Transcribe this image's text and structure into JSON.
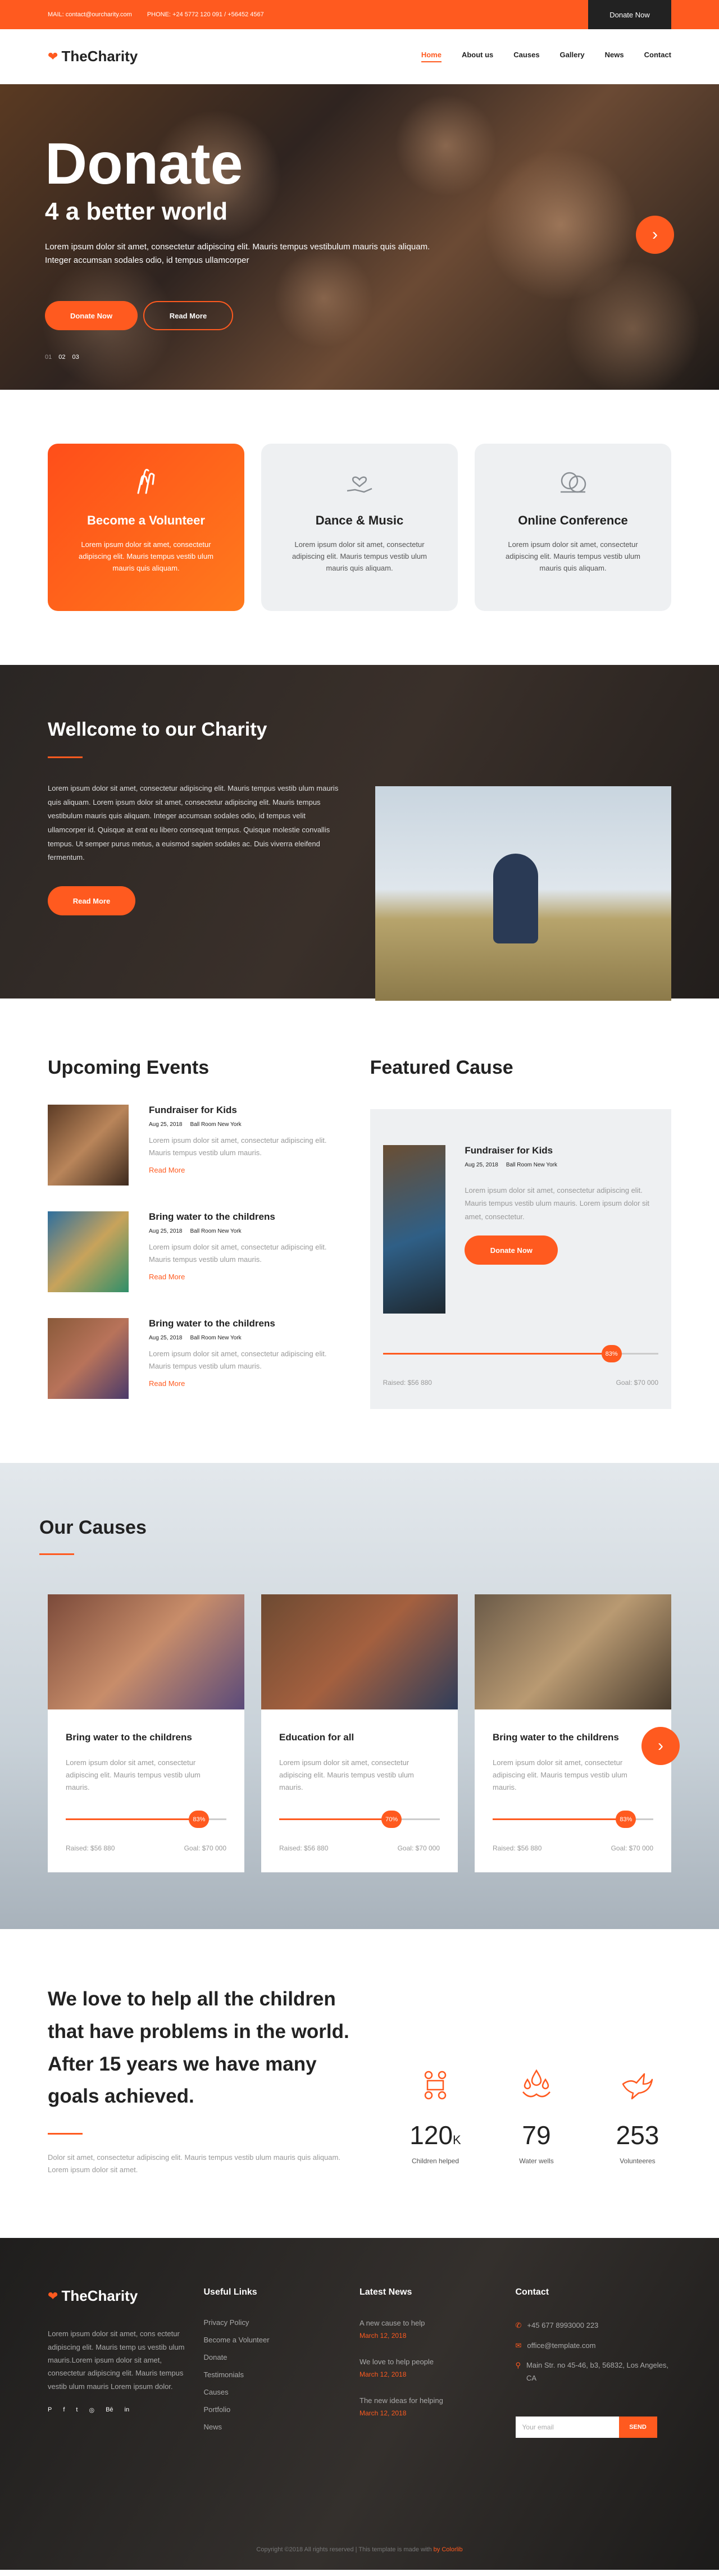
{
  "topbar": {
    "mail": "MAIL: contact@ourcharity.com",
    "phone": "PHONE: +24 5772 120 091 / +56452 4567",
    "donate": "Donate Now"
  },
  "nav": {
    "logo": "TheCharity",
    "items": [
      "Home",
      "About us",
      "Causes",
      "Gallery",
      "News",
      "Contact"
    ]
  },
  "hero": {
    "title": "Donate",
    "subtitle": "4 a better world",
    "text": "Lorem ipsum dolor sit amet, consectetur adipiscing elit. Mauris tempus vestibulum mauris quis aliquam. Integer accumsan sodales odio, id tempus ullamcorper",
    "btn_donate": "Donate Now",
    "btn_read": "Read More",
    "pages": [
      "01",
      "02",
      "03"
    ],
    "arrow": "›"
  },
  "features": [
    {
      "title": "Become a Volunteer",
      "text": "Lorem ipsum dolor sit amet, consectetur adipiscing elit. Mauris tempus vestib ulum mauris quis aliquam.",
      "icon": "hands-icon"
    },
    {
      "title": "Dance & Music",
      "text": "Lorem ipsum dolor sit amet, consectetur adipiscing elit. Mauris tempus vestib ulum mauris quis aliquam.",
      "icon": "heart-hand-icon"
    },
    {
      "title": "Online Conference",
      "text": "Lorem ipsum dolor sit amet, consectetur adipiscing elit. Mauris tempus vestib ulum mauris quis aliquam.",
      "icon": "money-icon"
    }
  ],
  "welcome": {
    "title": "Wellcome to our Charity",
    "text": "Lorem ipsum dolor sit amet, consectetur adipiscing elit. Mauris tempus vestib ulum mauris quis aliquam. Lorem ipsum dolor sit amet, consectetur adipiscing elit. Mauris tempus vestibulum mauris quis aliquam. Integer accumsan sodales odio, id tempus velit ullamcorper id. Quisque at erat eu libero consequat tempus. Quisque molestie convallis tempus. Ut semper purus metus, a euismod sapien sodales ac. Duis viverra eleifend fermentum.",
    "btn": "Read More"
  },
  "events": {
    "title": "Upcoming Events",
    "items": [
      {
        "title": "Fundraiser for Kids",
        "date": "Aug 25, 2018",
        "place": "Ball Room New York",
        "text": "Lorem ipsum dolor sit amet, consectetur adipiscing elit. Mauris tempus vestib ulum mauris.",
        "more": "Read More"
      },
      {
        "title": "Bring water to the childrens",
        "date": "Aug 25, 2018",
        "place": "Ball Room New York",
        "text": "Lorem ipsum dolor sit amet, consectetur adipiscing elit. Mauris tempus vestib ulum mauris.",
        "more": "Read More"
      },
      {
        "title": "Bring water to the childrens",
        "date": "Aug 25, 2018",
        "place": "Ball Room New York",
        "text": "Lorem ipsum dolor sit amet, consectetur adipiscing elit. Mauris tempus vestib ulum mauris.",
        "more": "Read More"
      }
    ]
  },
  "featured": {
    "title": "Featured Cause",
    "cause_title": "Fundraiser for Kids",
    "date": "Aug 25, 2018",
    "place": "Ball Room New York",
    "text": "Lorem ipsum dolor sit amet, consectetur adipiscing elit. Mauris tempus vestib ulum mauris. Lorem ipsum dolor sit amet, consectetur.",
    "btn": "Donate Now",
    "percent_label": "83%",
    "percent": 83,
    "raised": "Raised: $56 880",
    "goal": "Goal: $70 000"
  },
  "causes": {
    "title": "Our Causes",
    "items": [
      {
        "title": "Bring water to the childrens",
        "text": "Lorem ipsum dolor sit amet, consectetur adipiscing elit. Mauris tempus vestib ulum mauris.",
        "percent_label": "83%",
        "percent": 83,
        "raised": "Raised: $56 880",
        "goal": "Goal: $70 000"
      },
      {
        "title": "Education for all",
        "text": "Lorem ipsum dolor sit amet, consectetur adipiscing elit. Mauris tempus vestib ulum mauris.",
        "percent_label": "70%",
        "percent": 70,
        "raised": "Raised: $56 880",
        "goal": "Goal: $70 000"
      },
      {
        "title": "Bring water to the childrens",
        "text": "Lorem ipsum dolor sit amet, consectetur adipiscing elit. Mauris tempus vestib ulum mauris.",
        "percent_label": "83%",
        "percent": 83,
        "raised": "Raised: $56 880",
        "goal": "Goal: $70 000"
      }
    ],
    "arrow": "›"
  },
  "stats": {
    "heading": "We love to help all the children that have problems in the world. After 15 years we have many goals achieved.",
    "text": "Dolor sit amet, consectetur adipiscing elit. Mauris tempus vestib ulum mauris quis aliquam. Lorem ipsum dolor sit amet.",
    "items": [
      {
        "value": "120",
        "suffix": "K",
        "label": "Children helped",
        "icon": "children-icon"
      },
      {
        "value": "79",
        "suffix": "",
        "label": "Water wells",
        "icon": "water-drops-icon"
      },
      {
        "value": "253",
        "suffix": "",
        "label": "Volunteeres",
        "icon": "dove-icon"
      }
    ]
  },
  "footer": {
    "logo": "TheCharity",
    "about": "Lorem ipsum dolor sit amet, cons ectetur adipiscing elit. Mauris temp us vestib ulum mauris.Lorem ipsum dolor sit amet, consectetur adipiscing elit. Mauris tempus vestib ulum mauris Lorem ipsum dolor.",
    "socials": [
      "P",
      "f",
      "t",
      "◎",
      "Bē",
      "in"
    ],
    "links_title": "Useful Links",
    "links": [
      "Privacy Policy",
      "Become a Volunteer",
      "Donate",
      "Testimonials",
      "Causes",
      "Portfolio",
      "News"
    ],
    "news_title": "Latest News",
    "news": [
      {
        "title": "A new cause to help",
        "date": "March 12, 2018"
      },
      {
        "title": "We love to help people",
        "date": "March 12, 2018"
      },
      {
        "title": "The new ideas for helping",
        "date": "March 12, 2018"
      }
    ],
    "contact_title": "Contact",
    "phone": "+45 677 8993000 223",
    "email": "office@template.com",
    "address": "Main Str. no 45-46, b3, 56832, Los Angeles, CA",
    "subscribe_placeholder": "Your email",
    "send": "SEND",
    "copyright": "Copyright ©2018 All rights reserved | This template is made with",
    "copyright_by": "by Colorlib"
  }
}
